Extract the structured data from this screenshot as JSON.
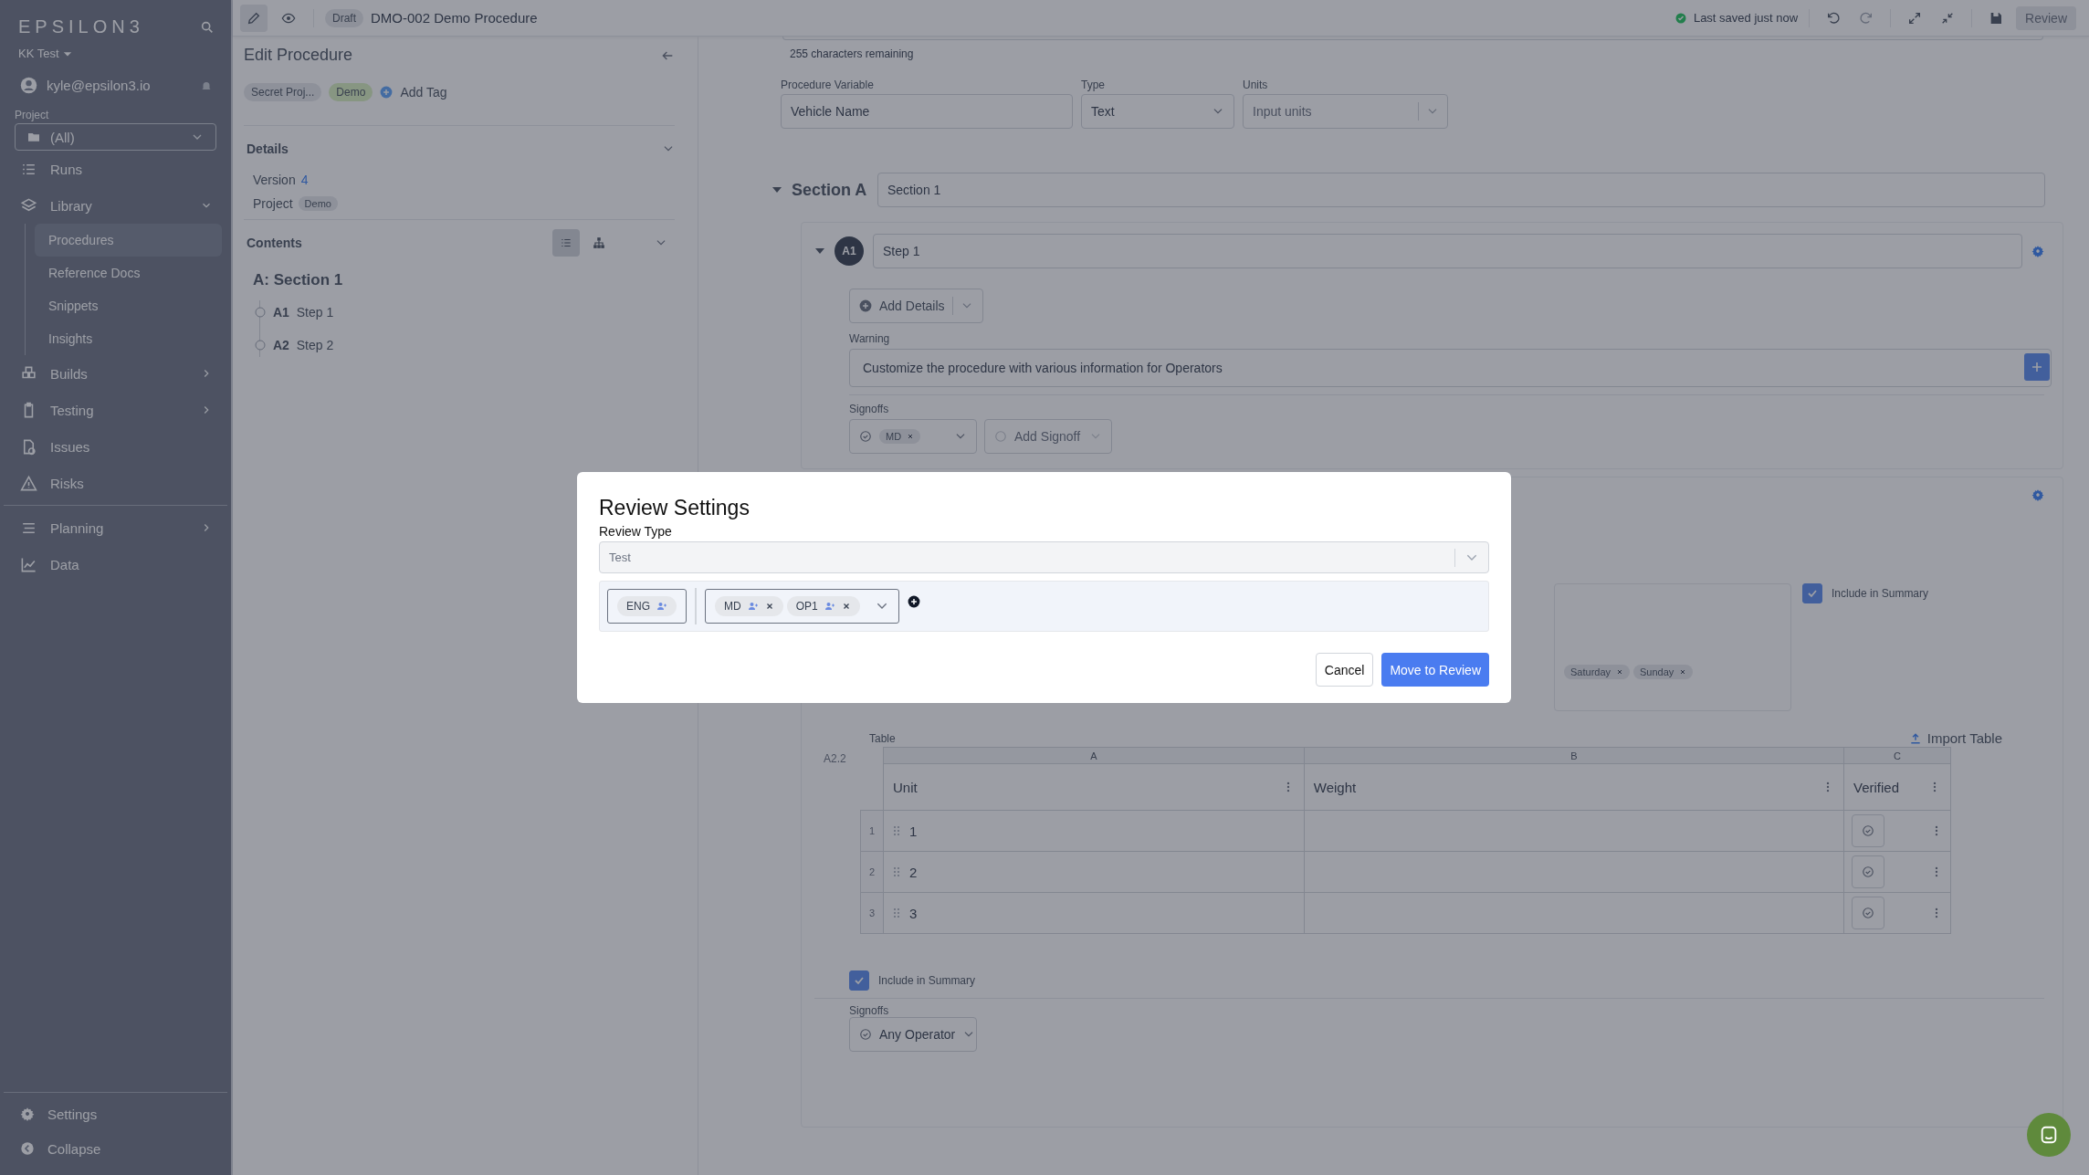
{
  "sidebar": {
    "logo": "EPSILON3",
    "workspace": "KK Test",
    "user": "kyle@epsilon3.io",
    "project_label": "Project",
    "project_value": "(All)",
    "nav": [
      {
        "label": "Runs"
      },
      {
        "label": "Library",
        "expanded": true,
        "children": [
          {
            "label": "Procedures",
            "selected": true
          },
          {
            "label": "Reference Docs",
            "selected": false
          },
          {
            "label": "Snippets",
            "selected": false
          },
          {
            "label": "Insights",
            "selected": false
          }
        ]
      },
      {
        "label": "Builds",
        "expanded": false
      },
      {
        "label": "Testing",
        "expanded": false
      },
      {
        "label": "Issues"
      },
      {
        "label": "Risks"
      },
      {
        "label": "Planning",
        "expanded": false
      },
      {
        "label": "Data"
      }
    ],
    "footer": [
      {
        "label": "Settings"
      },
      {
        "label": "Collapse"
      }
    ]
  },
  "top_bar": {
    "modes": [
      {
        "kind": "edit",
        "selected": true
      },
      {
        "kind": "view",
        "selected": false
      }
    ],
    "status": "Draft",
    "title": "DMO-002 Demo Procedure",
    "saved": "Last saved just now",
    "review_button": "Review"
  },
  "edit_panel": {
    "title": "Edit Procedure",
    "tags": [
      {
        "label": "Secret Proj...",
        "kind": "plain"
      },
      {
        "label": "Demo",
        "kind": "green"
      }
    ],
    "add_tag": "Add Tag",
    "details": {
      "title": "Details",
      "version_label": "Version",
      "version": "4",
      "project_label": "Project",
      "project": "Demo"
    },
    "contents": {
      "title": "Contents",
      "views": [
        {
          "kind": "list",
          "selected": true
        },
        {
          "kind": "tree",
          "selected": false
        }
      ],
      "section": "A: Section 1",
      "steps": [
        {
          "id": "A1",
          "name": "Step 1"
        },
        {
          "id": "A2",
          "name": "Step 2"
        }
      ]
    }
  },
  "editor": {
    "chars_remaining": "255 characters remaining",
    "variable": {
      "label": "Procedure Variable",
      "value": "Vehicle Name"
    },
    "type": {
      "label": "Type",
      "value": "Text"
    },
    "units": {
      "label": "Units",
      "placeholder": "Input units"
    },
    "section": {
      "label": "Section A",
      "value": "Section 1"
    },
    "step": {
      "badge": "A1",
      "value": "Step 1",
      "add_details": "Add Details",
      "warning_label": "Warning",
      "warning": "Customize the procedure with various information for Operators",
      "signoffs_label": "Signoffs",
      "signoffs": [
        "MD"
      ],
      "add_signoff": "Add Signoff"
    },
    "step2": {
      "include_summary": {
        "label": "Include in Summary",
        "checked": true
      },
      "days": [
        "Saturday",
        "Sunday"
      ],
      "table": {
        "label": "Table",
        "id": "A2.2",
        "import": "Import Table",
        "columns": [
          {
            "letter": "A",
            "header": "Unit"
          },
          {
            "letter": "B",
            "header": "Weight"
          },
          {
            "letter": "C",
            "header": "Verified"
          }
        ],
        "rows": [
          {
            "number": "1",
            "unit": "1"
          },
          {
            "number": "2",
            "unit": "2"
          },
          {
            "number": "3",
            "unit": "3"
          }
        ]
      },
      "include_summary_bottom": {
        "label": "Include in Summary",
        "checked": true
      },
      "signoffs_label": "Signoffs",
      "signoff": "Any Operator"
    }
  },
  "modal": {
    "title": "Review Settings",
    "type_label": "Review Type",
    "type_value": "Test",
    "groups": [
      [
        "ENG"
      ],
      [
        "MD",
        "OP1"
      ]
    ],
    "cancel": "Cancel",
    "confirm": "Move to Review"
  }
}
